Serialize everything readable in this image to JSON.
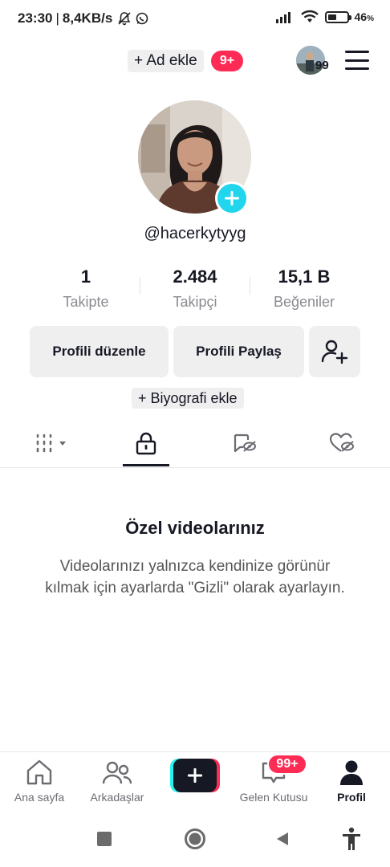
{
  "status_bar": {
    "time": "23:30",
    "separator": "|",
    "network_speed": "8,4KB/s",
    "battery_percent": "46",
    "battery_unit": "%",
    "battery_level": 0.46
  },
  "top_bar": {
    "add_account_label": "+ Ad ekle",
    "notification_badge": "9+",
    "story_count": "99"
  },
  "profile": {
    "username": "@hacerkytyyg",
    "stats": [
      {
        "value": "1",
        "label": "Takipte"
      },
      {
        "value": "2.484",
        "label": "Takipçi"
      },
      {
        "value": "15,1 B",
        "label": "Beğeniler"
      }
    ],
    "edit_profile_label": "Profili düzenle",
    "share_profile_label": "Profili Paylaş",
    "add_bio_label": "+ Biyografi ekle"
  },
  "tabs": [
    {
      "icon": "grid-icon",
      "active": false
    },
    {
      "icon": "lock-icon",
      "active": true
    },
    {
      "icon": "hidden-repost-icon",
      "active": false
    },
    {
      "icon": "hidden-liked-icon",
      "active": false
    }
  ],
  "empty_state": {
    "title": "Özel videolarınız",
    "description": "Videolarınızı yalnızca kendinize görünür kılmak için ayarlarda \"Gizli\" olarak ayarlayın."
  },
  "bottom_nav": {
    "home_label": "Ana sayfa",
    "friends_label": "Arkadaşlar",
    "inbox_label": "Gelen Kutusu",
    "inbox_badge": "99+",
    "profile_label": "Profil"
  },
  "colors": {
    "accent_red": "#fe2c55",
    "accent_cyan": "#25f4ee",
    "avatar_add": "#20d5ec",
    "text_primary": "#161823",
    "text_secondary": "#8a8b91",
    "button_bg": "#efeff0"
  }
}
